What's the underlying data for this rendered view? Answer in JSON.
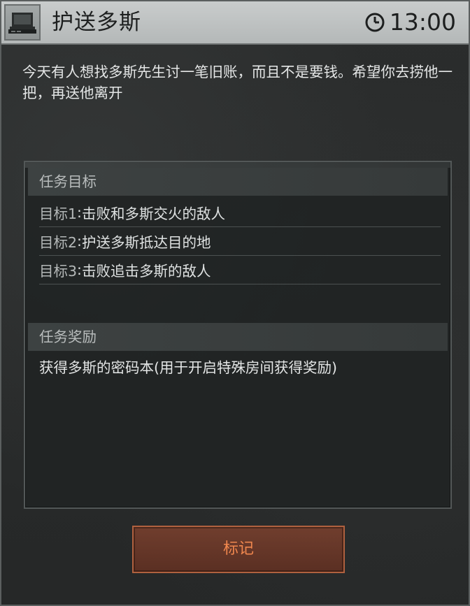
{
  "header": {
    "title": "护送多斯",
    "time": "13:00",
    "icon": "computer-terminal-icon",
    "clock_icon": "clock-icon"
  },
  "intro": {
    "text": "今天有人想找多斯先生讨一笔旧账，而且不是要钱。希望你去捞他一把，再送他离开"
  },
  "objectives": {
    "heading": "任务目标",
    "items": [
      {
        "prefix": "目标1",
        "text": "击败和多斯交火的敌人"
      },
      {
        "prefix": "目标2",
        "text": "护送多斯抵达目的地"
      },
      {
        "prefix": "目标3",
        "text": "击败追击多斯的敌人"
      }
    ]
  },
  "rewards": {
    "heading": "任务奖励",
    "text": "获得多斯的密码本(用于开启特殊房间获得奖励)"
  },
  "actions": {
    "mark_label": "标记"
  },
  "colors": {
    "header_bg": "#c2c5c5",
    "panel_bg": "#212424",
    "button_text": "#f0874e",
    "button_border": "#b0613f"
  }
}
